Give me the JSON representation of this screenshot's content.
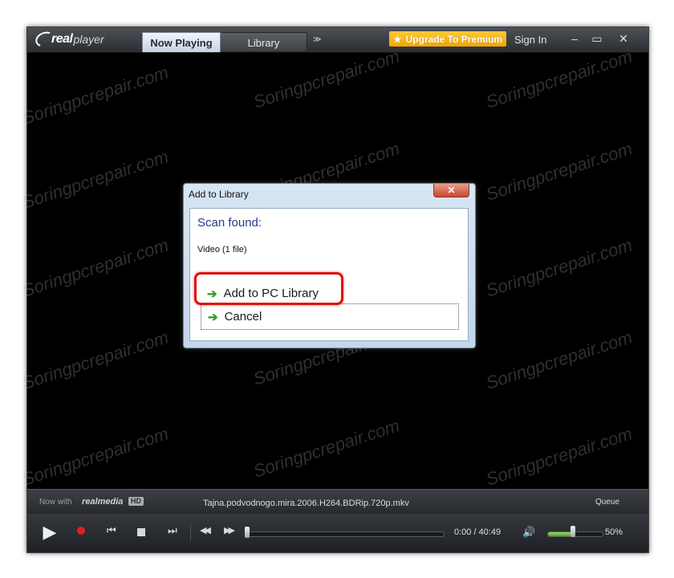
{
  "app": {
    "logo_text_real": "real",
    "logo_text_player": "player",
    "tabs": [
      {
        "label": "Now Playing",
        "active": true
      },
      {
        "label": "Library",
        "active": false
      }
    ],
    "more_glyph": "≫",
    "upgrade_label": "Upgrade To Premium",
    "signin_label": "Sign In",
    "window_buttons": {
      "minimize": "–",
      "maximize": "▭",
      "close": "✕"
    }
  },
  "dialog": {
    "title": "Add to Library",
    "close_glyph": "✕",
    "heading": "Scan found:",
    "subtext": "Video (1 file)",
    "commands": [
      {
        "label": "Add to PC Library",
        "icon": "green-arrow-icon"
      },
      {
        "label": "Cancel",
        "icon": "green-arrow-icon"
      }
    ]
  },
  "infobar": {
    "now_with": "Now with",
    "realmedia": "realmedia",
    "hd": "HD",
    "filename": "Tajna.podvodnogo.mira.2006.H264.BDRip.720p.mkv",
    "queue": "Queue"
  },
  "controls": {
    "time": "0:00 / 40:49",
    "progress": 0,
    "volume_percent": 50,
    "volume_label": "50%"
  },
  "watermark": "Soringpcrepair.com",
  "colors": {
    "accent_orange": "#f0a500",
    "highlight_red": "#e01010",
    "dialog_heading_blue": "#1e3e8c",
    "arrow_green": "#2da02a"
  }
}
